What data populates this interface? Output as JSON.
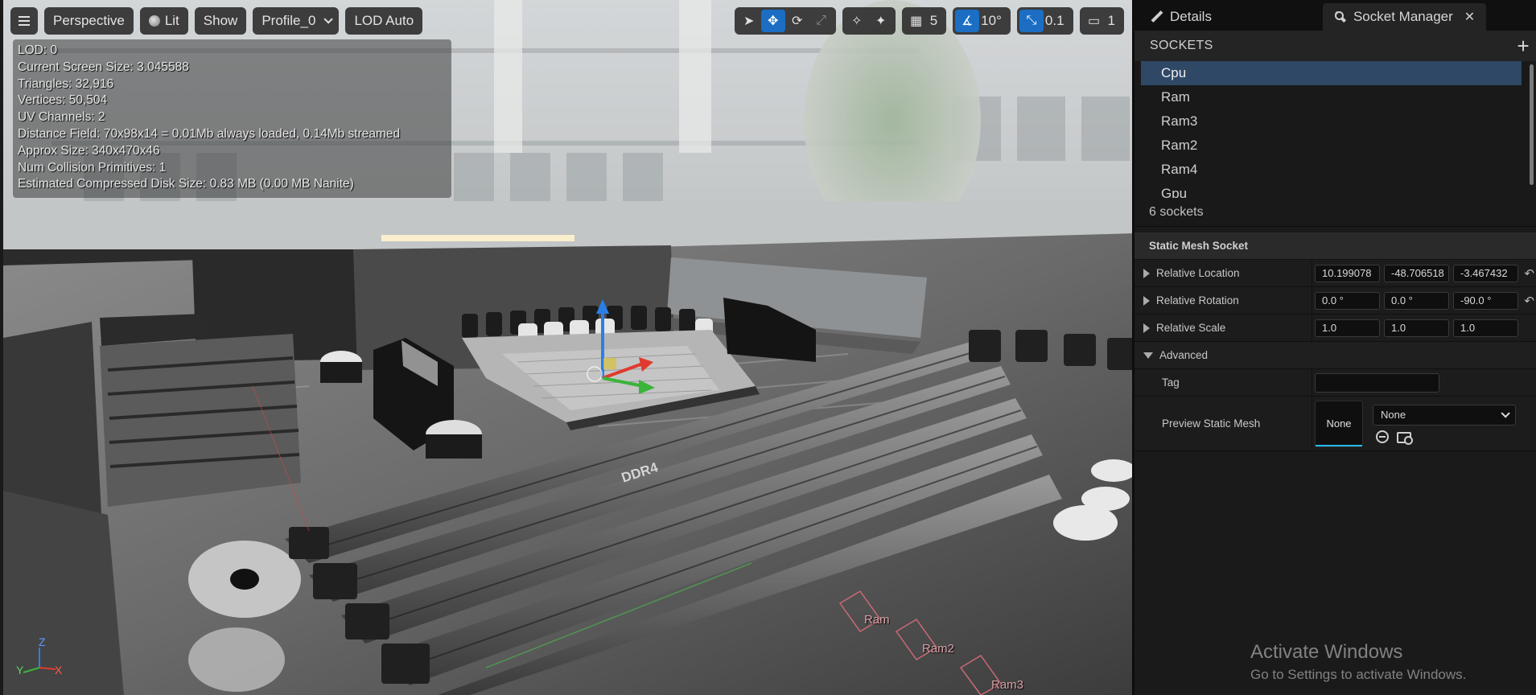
{
  "viewport": {
    "toolbar": {
      "view_mode": "Perspective",
      "lighting": "Lit",
      "show": "Show",
      "profile": "Profile_0",
      "lod": "LOD Auto",
      "grid_snap": "5",
      "rotation_snap": "10°",
      "scale_snap": "0.1",
      "camera_speed": "1"
    },
    "stats": [
      "LOD:  0",
      "Current Screen Size:  3.045588",
      "Triangles:  32,916",
      "Vertices:  50,504",
      "UV Channels:  2",
      "Distance Field:  70x98x14 = 0.01Mb always loaded, 0.14Mb streamed",
      "Approx Size: 340x470x46",
      "Num Collision Primitives:  1",
      "Estimated Compressed Disk Size: 0.83 MB (0.00 MB Nanite)"
    ],
    "axes": {
      "x": "X",
      "y": "Y",
      "z": "Z"
    },
    "scene_labels": {
      "ddr": "DDR4",
      "socket_ram": "Ram",
      "socket_ram2": "Ram2",
      "socket_ram3": "Ram3"
    }
  },
  "watermark": {
    "line1": "Activate Windows",
    "line2": "Go to Settings to activate Windows."
  },
  "panel": {
    "tabs": [
      {
        "label": "Details"
      },
      {
        "label": "Socket Manager"
      }
    ],
    "sockets_title": "SOCKETS",
    "sockets": [
      "Cpu",
      "Ram",
      "Ram3",
      "Ram2",
      "Ram4",
      "Gpu"
    ],
    "selected_socket": "Cpu",
    "socket_count": "6 sockets",
    "category": "Static Mesh Socket",
    "relative_location": {
      "label": "Relative Location",
      "values": [
        "10.199078",
        "-48.706518",
        "-3.467432"
      ]
    },
    "relative_rotation": {
      "label": "Relative Rotation",
      "values": [
        "0.0 °",
        "0.0 °",
        "-90.0 °"
      ]
    },
    "relative_scale": {
      "label": "Relative Scale",
      "values": [
        "1.0",
        "1.0",
        "1.0"
      ]
    },
    "advanced": "Advanced",
    "tag": {
      "label": "Tag",
      "value": ""
    },
    "preview": {
      "label": "Preview Static Mesh",
      "thumb": "None",
      "combo": "None"
    }
  },
  "colors": {
    "selection": "#2f4866",
    "accent": "#1b6ec4",
    "thumb_underline": "#26bbff",
    "gizmo_x": "#e03a2e",
    "gizmo_y": "#3bb43b",
    "gizmo_z": "#2a7fe6"
  }
}
